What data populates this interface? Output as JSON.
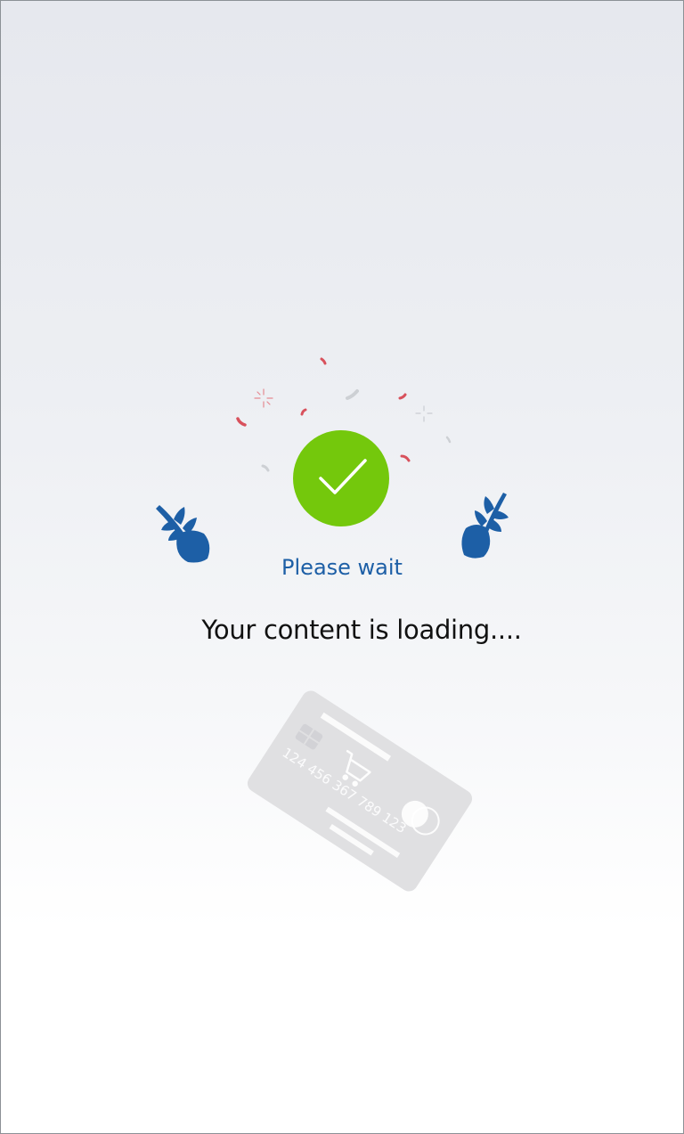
{
  "status": {
    "title": "Please wait",
    "message": "Your content is loading...."
  },
  "illustration": {
    "icons": [
      "checkmark-icon",
      "leaf-icon",
      "confetti-icon",
      "credit-card-icon",
      "shopping-cart-icon"
    ],
    "card_number": "124 456 367 789 123"
  },
  "colors": {
    "success": "#74c80c",
    "brand_blue": "#1d5fa6",
    "text": "#111111",
    "card": "#e0e0e2",
    "confetti_red": "#d8515c",
    "confetti_gray": "#cdd0d4"
  }
}
